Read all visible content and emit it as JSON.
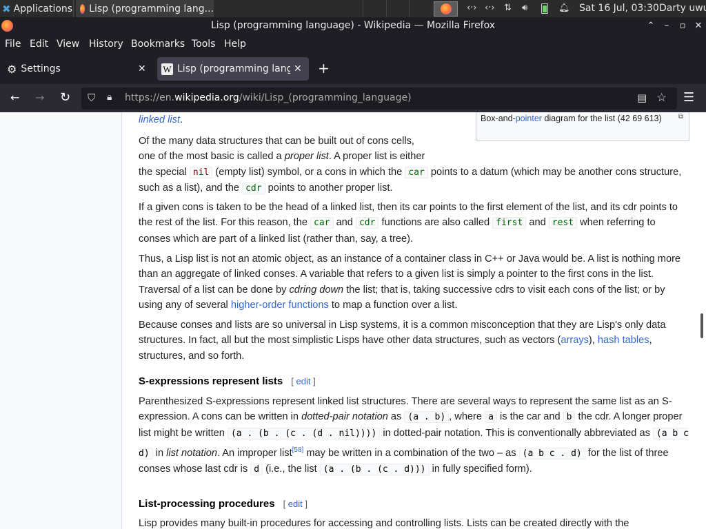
{
  "taskbar": {
    "applications_label": "Applications",
    "window_title": "Lisp (programming lang...",
    "clock": "Sat 16 Jul, 03:30",
    "user": "Darty uwu"
  },
  "window": {
    "title": "Lisp (programming language) - Wikipedia — Mozilla Firefox"
  },
  "menu": {
    "file": "File",
    "edit": "Edit",
    "view": "View",
    "history": "History",
    "bookmarks": "Bookmarks",
    "tools": "Tools",
    "help": "Help"
  },
  "tabs": [
    {
      "label": "Settings"
    },
    {
      "label": "Lisp (programming langu"
    }
  ],
  "url": {
    "prefix": "https://en.",
    "domain": "wikipedia.org",
    "path": "/wiki/Lisp_(programming_language)"
  },
  "article": {
    "linked_list_tail": "linked list",
    "caption_a": "Box-and-",
    "caption_link": "pointer",
    "caption_b": " diagram for the list (42 69 613)",
    "p1": {
      "a": "Of the many data structures that can be built out of cons cells,",
      "b": "one of the most basic is called a ",
      "em": "proper list",
      "c": ". A proper list is either",
      "d": "the special ",
      "nil": "nil",
      "e": " (empty list) symbol, or a cons in which the ",
      "car": "car",
      "f": " points to a datum (which may be another cons structure, such as a list), and the ",
      "cdr": "cdr",
      "g": " points to another proper list."
    },
    "p2": {
      "a": "If a given cons is taken to be the head of a linked list, then its car points to the first element of the list, and its cdr points to the rest of the list. For this reason, the ",
      "car": "car",
      "b": " and ",
      "cdr": "cdr",
      "c": " functions are also called ",
      "first": "first",
      "d": " and ",
      "rest": "rest",
      "e": " when referring to conses which are part of a linked list (rather than, say, a tree)."
    },
    "p3": {
      "a": "Thus, a Lisp list is not an atomic object, as an instance of a container class in C++ or Java would be. A list is nothing more than an aggregate of linked conses. A variable that refers to a given list is simply a pointer to the first cons in the list. Traversal of a list can be done by ",
      "em": "cdring down",
      "b": " the list; that is, taking successive cdrs to visit each cons of the list; or by using any of several ",
      "link": "higher-order functions",
      "c": " to map a function over a list."
    },
    "p4": {
      "a": "Because conses and lists are so universal in Lisp systems, it is a common misconception that they are Lisp's only data structures. In fact, all but the most simplistic Lisps have other data structures, such as vectors (",
      "link1": "arrays",
      "b": "), ",
      "link2": "hash tables",
      "c": ", structures, and so forth."
    },
    "h_sexp": "S-expressions represent lists",
    "edit_label": "edit",
    "p5": {
      "a": "Parenthesized S-expressions represent linked list structures. There are several ways to represent the same list as an S-expression. A cons can be written in ",
      "em1": "dotted-pair notation",
      "b": " as ",
      "code1": "(a . b)",
      "c": ", where ",
      "code2": "a",
      "d": " is the car and ",
      "code3": "b",
      "e": " the cdr. A longer proper list might be written ",
      "code4": "(a . (b . (c . (d . nil))))",
      "f": " in dotted-pair notation. This is conventionally abbreviated as ",
      "code5": "(a b c d)",
      "g": " in ",
      "em2": "list notation",
      "h": ". An improper list",
      "ref": "[58]",
      "i": " may be written in a combination of the two – as ",
      "code6": "(a b c . d)",
      "j": " for the list of three conses whose last cdr is ",
      "code7": "d",
      "k": " (i.e., the list ",
      "code8": "(a . (b . (c . d)))",
      "l": " in fully specified form)."
    },
    "h_listproc": "List-processing procedures",
    "p6": "Lisp provides many built-in procedures for accessing and controlling lists. Lists can be created directly with the"
  }
}
